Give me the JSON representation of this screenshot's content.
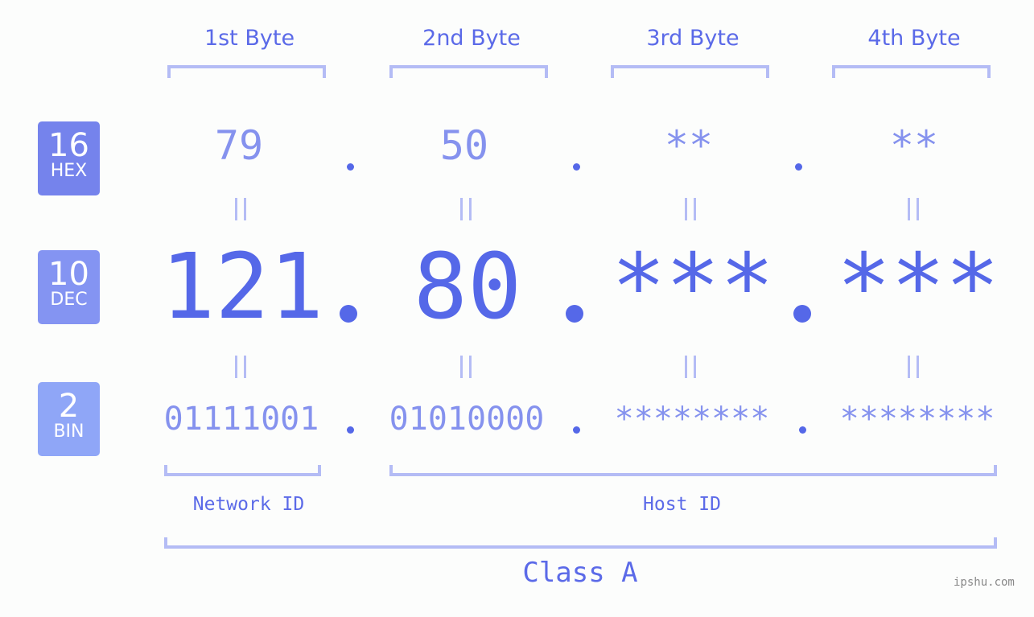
{
  "headers": [
    "1st Byte",
    "2nd Byte",
    "3rd Byte",
    "4th Byte"
  ],
  "badges": {
    "hex": {
      "num": "16",
      "label": "HEX",
      "color": "#7583ec"
    },
    "dec": {
      "num": "10",
      "label": "DEC",
      "color": "#8494f2"
    },
    "bin": {
      "num": "2",
      "label": "BIN",
      "color": "#8fa6f7"
    }
  },
  "hex": [
    "79",
    "50",
    "**",
    "**"
  ],
  "dec": [
    "121",
    "80",
    "***",
    "***"
  ],
  "bin": [
    "01111001",
    "01010000",
    "********",
    "********"
  ],
  "equals": "=",
  "network_label": "Network ID",
  "host_label": "Host ID",
  "class_label": "Class A",
  "watermark": "ipshu.com",
  "colors": {
    "accent": "#5568e8",
    "light": "#8592ee",
    "bracket": "#b4bcf5"
  }
}
